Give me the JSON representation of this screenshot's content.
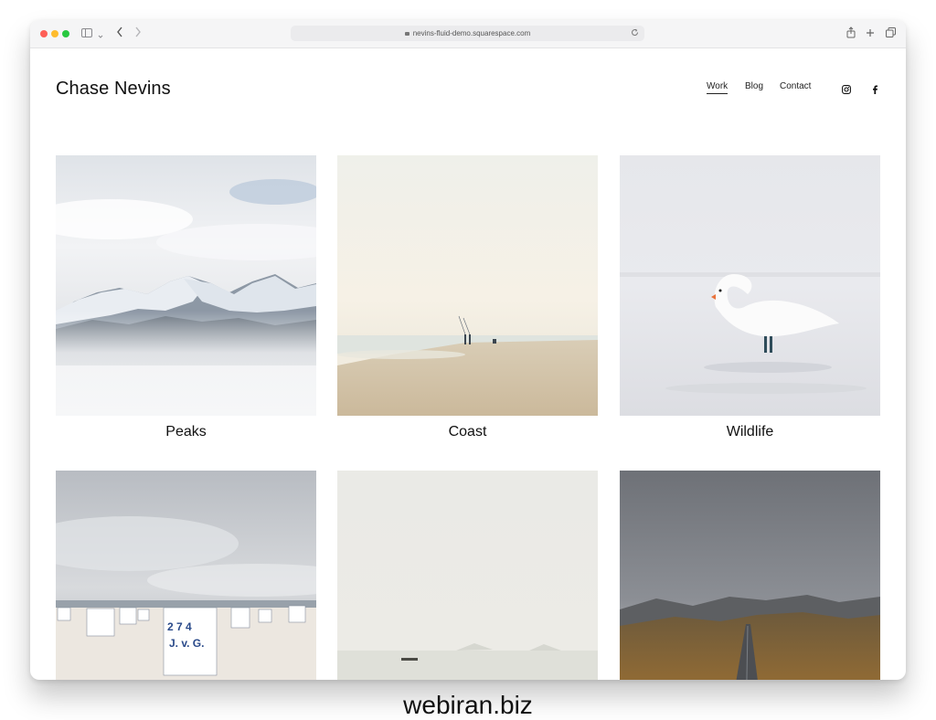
{
  "browser": {
    "url": "nevins-fluid-demo.squarespace.com",
    "icons": [
      "sidebar-icon",
      "chevron-down-icon",
      "back-icon",
      "forward-icon",
      "lock-icon",
      "reload-icon",
      "share-icon",
      "new-tab-icon",
      "tabs-overview-icon"
    ]
  },
  "site": {
    "title": "Chase Nevins",
    "nav": [
      {
        "label": "Work",
        "active": true
      },
      {
        "label": "Blog",
        "active": false
      },
      {
        "label": "Contact",
        "active": false
      }
    ],
    "social": [
      "instagram-icon",
      "facebook-icon"
    ]
  },
  "gallery": [
    {
      "caption": "Peaks"
    },
    {
      "caption": "Coast"
    },
    {
      "caption": "Wildlife"
    },
    {
      "caption": ""
    },
    {
      "caption": ""
    },
    {
      "caption": ""
    }
  ],
  "watermark": "webiran.biz",
  "colors": {
    "traffic_red": "#fe5f57",
    "traffic_yellow": "#febc2e",
    "traffic_green": "#28c840"
  }
}
